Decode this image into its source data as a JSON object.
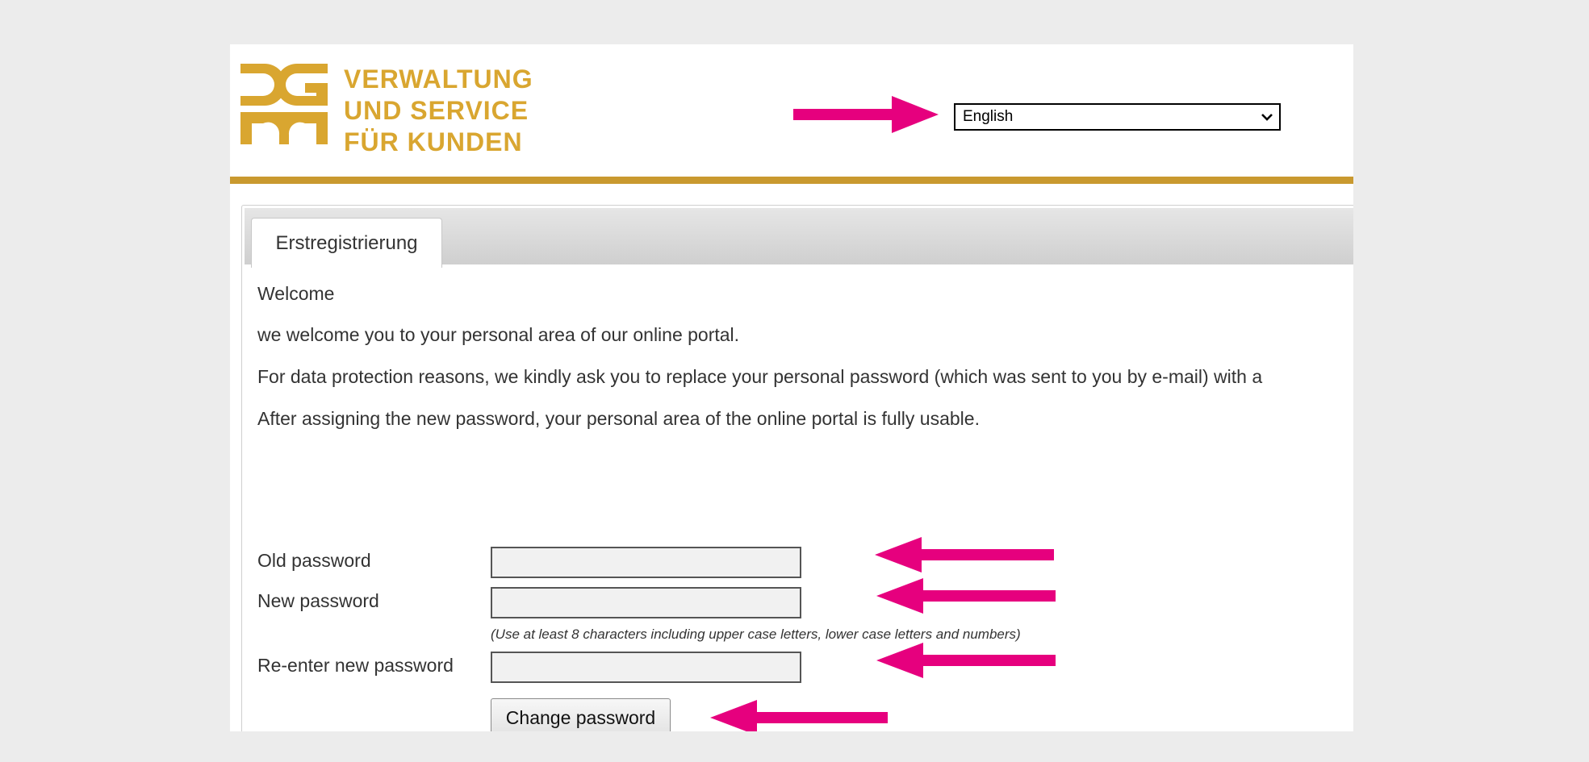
{
  "header": {
    "logo_lines": [
      "VERWALTUNG",
      "UND SERVICE",
      "FÜR KUNDEN"
    ],
    "language_selected": "English"
  },
  "tabs": [
    {
      "label": "Erstregistrierung"
    }
  ],
  "intro": {
    "greeting": "Welcome",
    "line1": "we welcome you to your personal area of our online portal.",
    "line2": "For data protection reasons, we kindly ask you to replace your personal password (which was sent to you by e-mail) with a",
    "line3": "After assigning the new password, your personal area of the online portal is fully usable."
  },
  "form": {
    "old_password_label": "Old password",
    "new_password_label": "New password",
    "hint": "(Use at least 8 characters including upper case letters, lower case letters and numbers)",
    "reenter_label": "Re-enter new password",
    "submit_label": "Change password"
  },
  "colors": {
    "brand_gold": "#d9a630",
    "header_bar": "#c9992f",
    "annotation_arrow": "#e6007e"
  },
  "icons": [
    "logo-mark",
    "chevron-down-icon",
    "annotation-arrow"
  ]
}
